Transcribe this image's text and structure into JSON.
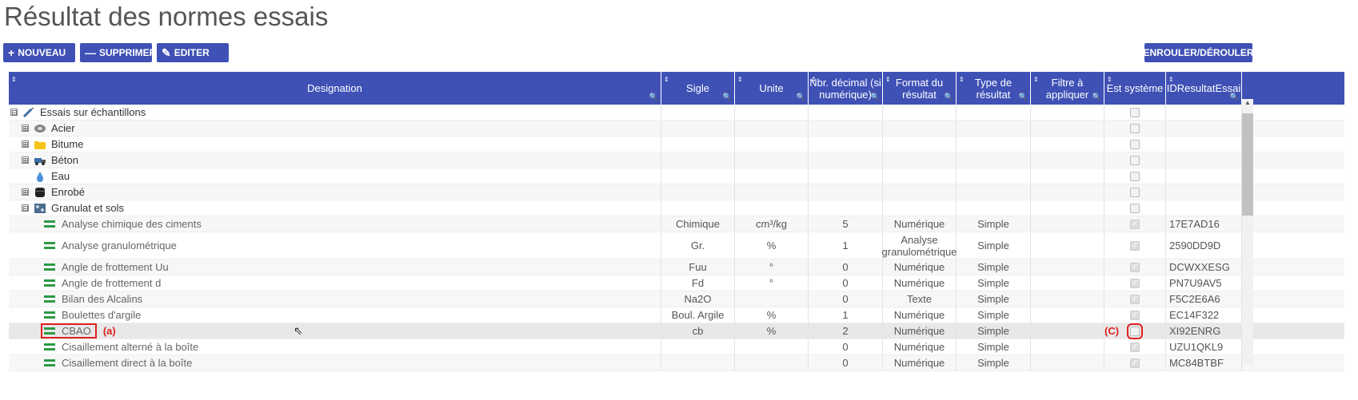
{
  "page": {
    "title": "Résultat des normes essais"
  },
  "toolbar": {
    "new_label": "NOUVEAU",
    "delete_label": "SUPPRIMER",
    "edit_label": "EDITER",
    "toggle_label": "ENROULER/DÉROULER"
  },
  "columns": [
    "Designation",
    "Sigle",
    "Unite",
    "Nbr. décimal (si numérique)",
    "Format du résultat",
    "Type de résultat",
    "Filtre à appliquer",
    "Est système",
    "IDResultatEssai"
  ],
  "tree": [
    {
      "label": "Essais sur échantillons",
      "icon": "syringe-icon",
      "expand": "⊟"
    },
    {
      "label": "Acier",
      "icon": "steel-coil-icon",
      "expand": "⊞"
    },
    {
      "label": "Bitume",
      "icon": "folder-icon",
      "expand": "⊞"
    },
    {
      "label": "Béton",
      "icon": "concrete-truck-icon",
      "expand": "⊞"
    },
    {
      "label": "Eau",
      "icon": "water-drop-icon",
      "expand": ""
    },
    {
      "label": "Enrobé",
      "icon": "barrel-icon",
      "expand": "⊞"
    },
    {
      "label": "Granulat et sols",
      "icon": "granulate-icon",
      "expand": "⊟"
    }
  ],
  "leaves": [
    {
      "name": "Analyse chimique des ciments",
      "sigle": "Chimique",
      "unite": "cm³/kg",
      "dec": "5",
      "format": "Numérique",
      "type": "Simple",
      "filtre": "",
      "id": "17E7AD16"
    },
    {
      "name": "Analyse granulométrique",
      "sigle": "Gr.",
      "unite": "%",
      "dec": "1",
      "format": "Analyse granulométrique",
      "type": "Simple",
      "filtre": "",
      "id": "2590DD9D"
    },
    {
      "name": "Angle de frottement Uu",
      "sigle": "Fuu",
      "unite": "°",
      "dec": "0",
      "format": "Numérique",
      "type": "Simple",
      "filtre": "",
      "id": "DCWXXESG"
    },
    {
      "name": "Angle de frottement d",
      "sigle": "Fd",
      "unite": "°",
      "dec": "0",
      "format": "Numérique",
      "type": "Simple",
      "filtre": "",
      "id": "PN7U9AV5"
    },
    {
      "name": "Bilan des Alcalins",
      "sigle": "Na2O",
      "unite": "",
      "dec": "0",
      "format": "Texte",
      "type": "Simple",
      "filtre": "",
      "id": "F5C2E6A6"
    },
    {
      "name": "Boulettes d'argile",
      "sigle": "Boul. Argile",
      "unite": "%",
      "dec": "1",
      "format": "Numérique",
      "type": "Simple",
      "filtre": "",
      "id": "EC14F322"
    },
    {
      "name": "CBAO",
      "sigle": "cb",
      "unite": "%",
      "dec": "2",
      "format": "Numérique",
      "type": "Simple",
      "filtre": "",
      "id": "XI92ENRG"
    },
    {
      "name": "Cisaillement alterné à la boîte",
      "sigle": "",
      "unite": "",
      "dec": "0",
      "format": "Numérique",
      "type": "Simple",
      "filtre": "",
      "id": "UZU1QKL9"
    },
    {
      "name": "Cisaillement direct à la boîte",
      "sigle": "",
      "unite": "",
      "dec": "0",
      "format": "Numérique",
      "type": "Simple",
      "filtre": "",
      "id": "MC84BTBF"
    }
  ],
  "annotations": {
    "a": "(a)",
    "c": "(C)"
  }
}
